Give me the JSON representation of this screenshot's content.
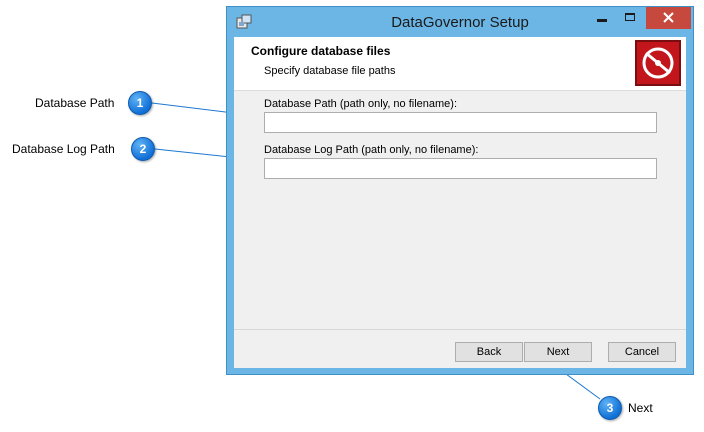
{
  "window": {
    "title": "DataGovernor Setup"
  },
  "header": {
    "title": "Configure database files",
    "subtitle": "Specify database file paths"
  },
  "fields": {
    "database_path_label": "Database Path (path only, no filename):",
    "database_path_value": "",
    "database_log_path_label": "Database Log Path (path only, no filename):",
    "database_log_path_value": ""
  },
  "buttons": {
    "back": "Back",
    "next": "Next",
    "cancel": "Cancel"
  },
  "callouts": [
    {
      "number": "1",
      "label": "Database Path"
    },
    {
      "number": "2",
      "label": "Database Log Path"
    },
    {
      "number": "3",
      "label": "Next"
    }
  ],
  "colors": {
    "window_frame": "#6cb6e6",
    "close_button": "#c7493e",
    "logo": "#c3161c",
    "callout_badge": "#1170d6"
  }
}
